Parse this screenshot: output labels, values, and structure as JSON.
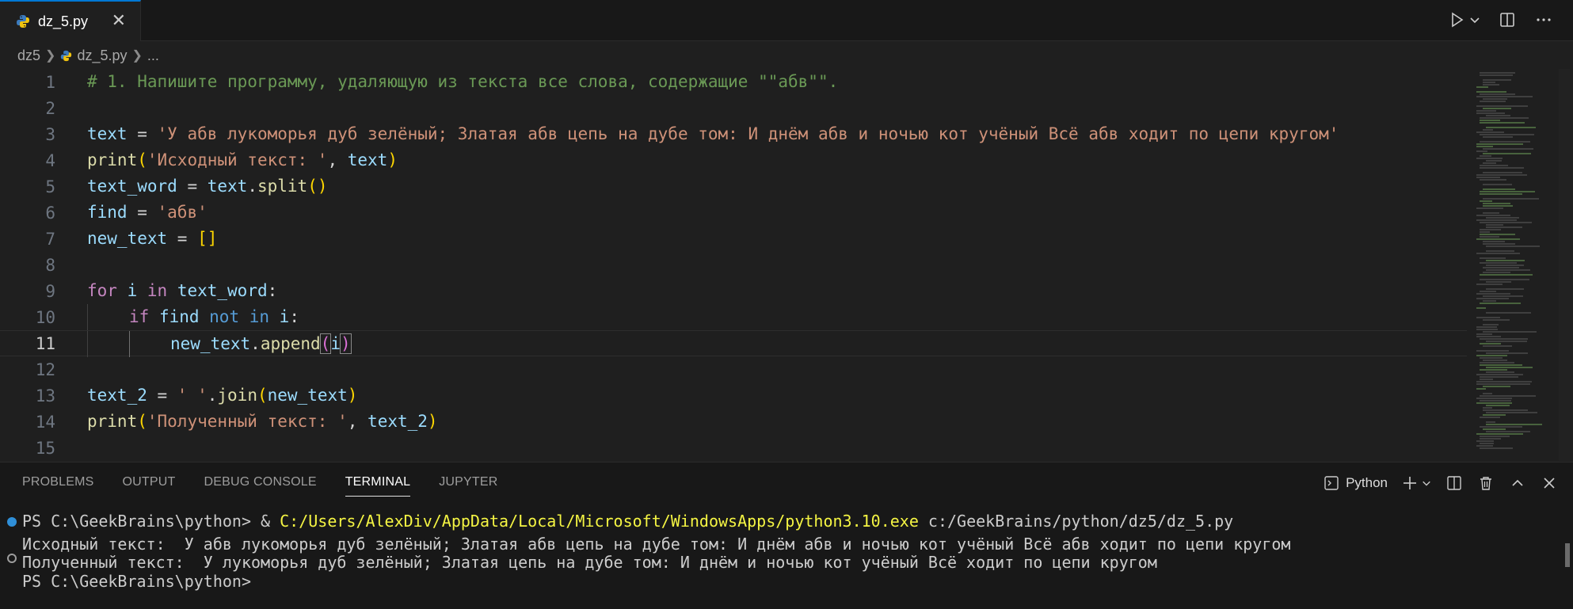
{
  "tab": {
    "label": "dz_5.py",
    "close": "✕"
  },
  "breadcrumb": {
    "folder": "dz5",
    "file": "dz_5.py",
    "more": "..."
  },
  "editor": {
    "line_numbers": [
      "1",
      "2",
      "3",
      "4",
      "5",
      "6",
      "7",
      "8",
      "9",
      "10",
      "11",
      "12",
      "13",
      "14",
      "15"
    ],
    "active_line": "11",
    "code": {
      "l1": "# 1. Напишите программу, удаляющую из текста все слова, содержащие \"\"абв\"\".",
      "l3_var": "text",
      "l3_op": " = ",
      "l3_str": "'У абв лукоморья дуб зелёный; Златая абв цепь на дубе том: И днём абв и ночью кот учёный Всё абв ходит по цепи кругом'",
      "l4_fn": "print",
      "l4_open": "(",
      "l4_str": "'Исходный текст: '",
      "l4_comma": ", ",
      "l4_var": "text",
      "l4_close": ")",
      "l5_var": "text_word",
      "l5_op": " = ",
      "l5_obj": "text",
      "l5_dot": ".",
      "l5_fn": "split",
      "l5_parens": "()",
      "l6_var": "find",
      "l6_op": " = ",
      "l6_str": "'абв'",
      "l7_var": "new_text",
      "l7_op": " = ",
      "l7_br": "[]",
      "l9_kw": "for",
      "l9_var": " i ",
      "l9_in": "in",
      "l9_iter": " text_word",
      "l9_colon": ":",
      "l10_kw": "if",
      "l10_var": " find ",
      "l10_not": "not",
      "l10_in": " in",
      "l10_i": " i",
      "l10_colon": ":",
      "l11_obj": "new_text",
      "l11_dot": ".",
      "l11_fn": "append",
      "l11_open": "(",
      "l11_arg": "i",
      "l11_close": ")",
      "l13_var": "text_2",
      "l13_op": " = ",
      "l13_str": "' '",
      "l13_dot": ".",
      "l13_fn": "join",
      "l13_open": "(",
      "l13_arg": "new_text",
      "l13_close": ")",
      "l14_fn": "print",
      "l14_open": "(",
      "l14_str": "'Полученный текст: '",
      "l14_comma": ", ",
      "l14_var": "text_2",
      "l14_close": ")"
    }
  },
  "panel": {
    "tabs": [
      "PROBLEMS",
      "OUTPUT",
      "DEBUG CONSOLE",
      "TERMINAL",
      "JUPYTER"
    ],
    "active_tab": "TERMINAL",
    "terminal_name": "Python",
    "terminal": {
      "prompt1": "PS C:\\GeekBrains\\python> & ",
      "exe": "C:/Users/AlexDiv/AppData/Local/Microsoft/WindowsApps/python3.10.exe",
      "script": " c:/GeekBrains/python/dz5/dz_5.py",
      "out1": "Исходный текст:  У абв лукоморья дуб зелёный; Златая абв цепь на дубе том: И днём абв и ночью кот учёный Всё абв ходит по цепи кругом",
      "out2": "Полученный текст:  У лукоморья дуб зелёный; Златая цепь на дубе том: И днём и ночью кот учёный Всё ходит по цепи кругом",
      "prompt2": "PS C:\\GeekBrains\\python>"
    }
  },
  "colors": {
    "accent": "#0078d4",
    "editor_bg": "#1f1f1f",
    "panel_bg": "#181818"
  }
}
